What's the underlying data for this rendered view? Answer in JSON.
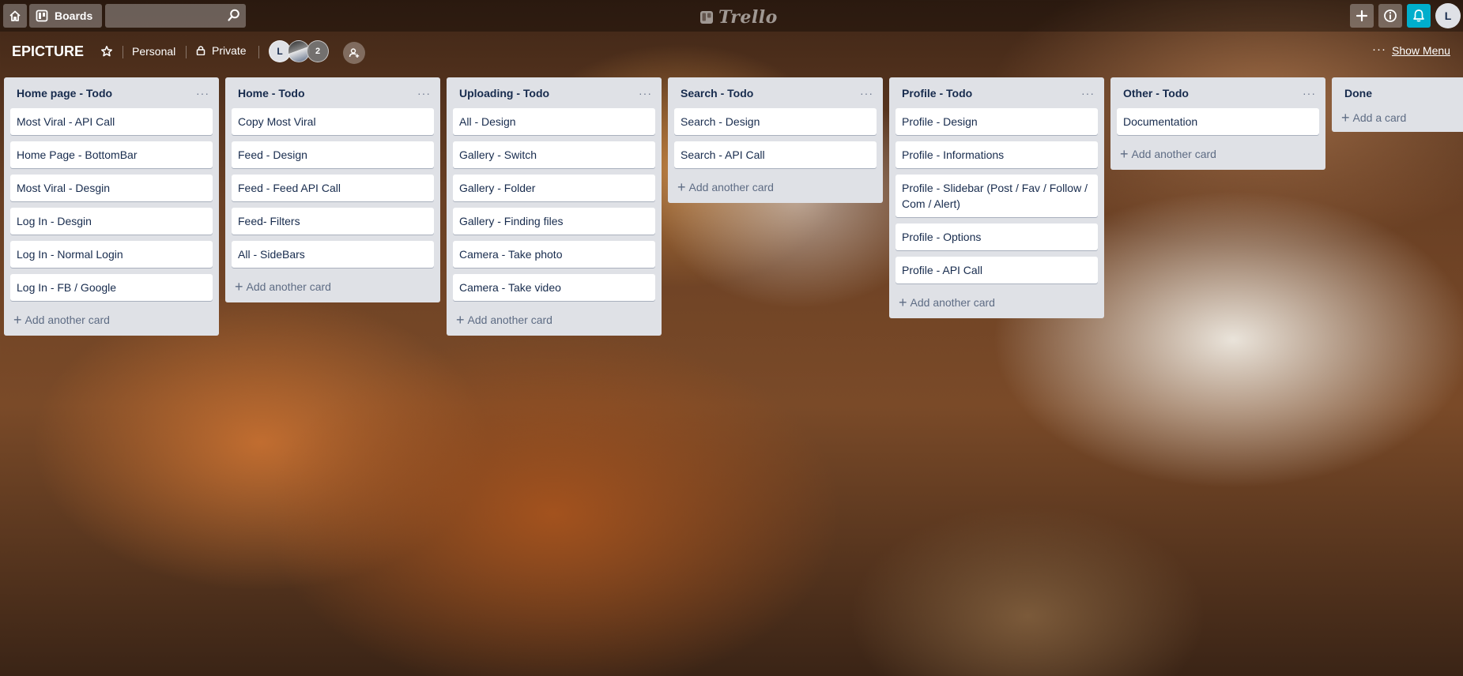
{
  "app": {
    "boards_label": "Boards",
    "search_value": "",
    "logo_text": "Trello",
    "user_initial": "L",
    "colors": {
      "notification_accent": "#00aecc",
      "list_bg": "#dfe1e6",
      "card_bg": "#ffffff"
    }
  },
  "board": {
    "title": "EPICTURE",
    "team": "Personal",
    "visibility": "Private",
    "members": {
      "initial": "L",
      "extra_count": "2"
    },
    "show_menu": "Show Menu"
  },
  "lists": [
    {
      "title": "Home page - Todo",
      "cards": [
        "Most Viral - API Call",
        "Home Page - BottomBar",
        "Most Viral - Desgin",
        "Log In - Desgin",
        "Log In - Normal Login",
        "Log In - FB / Google"
      ],
      "add_label": "Add another card"
    },
    {
      "title": "Home - Todo",
      "cards": [
        "Copy Most Viral",
        "Feed - Design",
        "Feed - Feed API Call",
        "Feed- Filters",
        "All - SideBars"
      ],
      "add_label": "Add another card"
    },
    {
      "title": "Uploading - Todo",
      "cards": [
        "All - Design",
        "Gallery - Switch",
        "Gallery - Folder",
        "Gallery - Finding files",
        "Camera - Take photo",
        "Camera - Take video"
      ],
      "add_label": "Add another card"
    },
    {
      "title": "Search - Todo",
      "cards": [
        "Search - Design",
        "Search - API Call"
      ],
      "add_label": "Add another card"
    },
    {
      "title": "Profile - Todo",
      "cards": [
        "Profile - Design",
        "Profile - Informations",
        "Profile - Slidebar (Post / Fav / Follow / Com / Alert)",
        "Profile - Options",
        "Profile - API Call"
      ],
      "add_label": "Add another card"
    },
    {
      "title": "Other - Todo",
      "cards": [
        "Documentation"
      ],
      "add_label": "Add another card"
    },
    {
      "title": "Done",
      "cards": [],
      "add_label": "Add a card"
    }
  ]
}
